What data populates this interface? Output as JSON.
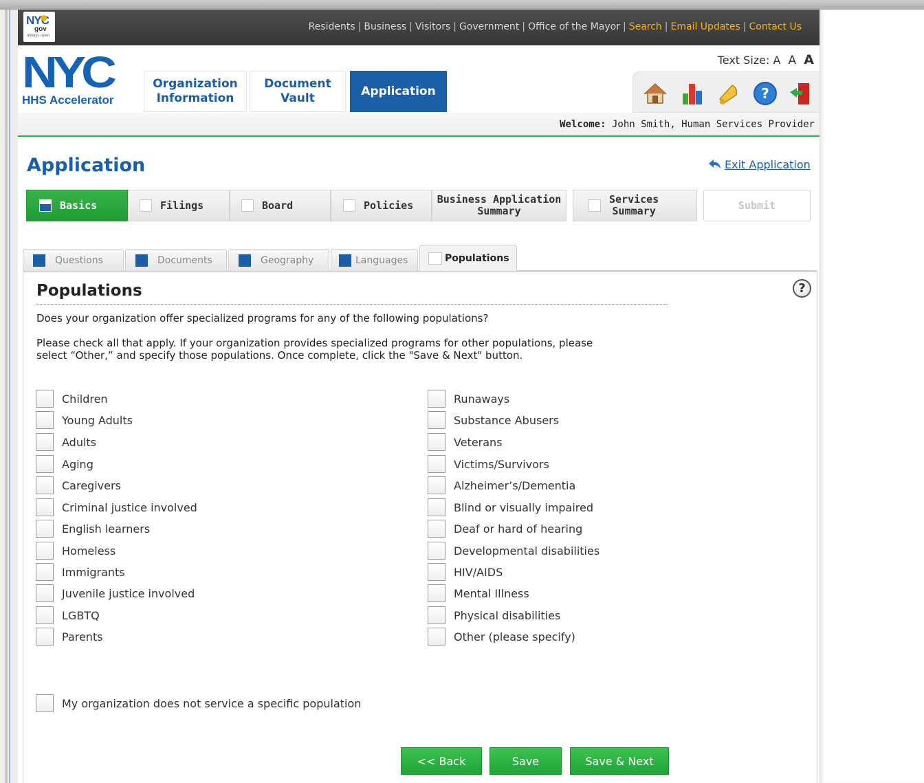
{
  "topnav": {
    "logo_text": "NYC",
    "logo_sub": "gov",
    "logo_tagline": "always open",
    "links": [
      {
        "label": "Residents",
        "highlight": false
      },
      {
        "label": "Business",
        "highlight": false
      },
      {
        "label": "Visitors",
        "highlight": false
      },
      {
        "label": "Government",
        "highlight": false
      },
      {
        "label": "Office of the Mayor",
        "highlight": false
      },
      {
        "label": "Search",
        "highlight": true
      },
      {
        "label": "Email Updates",
        "highlight": true
      },
      {
        "label": "Contact Us",
        "highlight": true
      }
    ],
    "link_color": "#d8d8d8",
    "highlight_color": "#f6b21b"
  },
  "header": {
    "logo_text": "NYC",
    "app_name": "HHS Accelerator",
    "tabs": [
      {
        "label_line1": "Organization",
        "label_line2": "Information",
        "active": false
      },
      {
        "label_line1": "Document",
        "label_line2": "Vault",
        "active": false
      },
      {
        "label_line1": "Application",
        "label_line2": "",
        "active": true
      }
    ],
    "text_size_label": "Text Size:",
    "text_size_options": [
      "A",
      "A",
      "A"
    ],
    "toolbar_icons": [
      "home-icon",
      "reports-chart-icon",
      "notifications-bell-icon",
      "help-icon",
      "logout-door-icon"
    ],
    "welcome_label": "Welcome:",
    "welcome_user": "John Smith, Human Services Provider",
    "accent_color": "#1a5fa7"
  },
  "page": {
    "title": "Application",
    "exit_link": "Exit Application"
  },
  "steps": [
    {
      "label1": "Basics",
      "label2": "",
      "state": "active"
    },
    {
      "label1": "Filings",
      "label2": "",
      "state": "normal"
    },
    {
      "label1": "Board",
      "label2": "",
      "state": "normal"
    },
    {
      "label1": "Policies",
      "label2": "",
      "state": "normal"
    },
    {
      "label1": "Business Application",
      "label2": "Summary",
      "state": "nocheck"
    },
    {
      "label1": "Services",
      "label2": "Summary",
      "state": "normal"
    },
    {
      "label1": "Submit",
      "label2": "",
      "state": "disabled"
    }
  ],
  "subtabs": [
    {
      "label": "Questions",
      "complete": true,
      "active": false
    },
    {
      "label": "Documents",
      "complete": true,
      "active": false
    },
    {
      "label": "Geography",
      "complete": true,
      "active": false
    },
    {
      "label": "Languages",
      "complete": true,
      "active": false
    },
    {
      "label": "Populations",
      "complete": false,
      "active": true
    }
  ],
  "form": {
    "title": "Populations",
    "question": "Does your organization offer specialized programs for any of the following populations?",
    "instructions_line1": "Please check all that apply. If your organization provides specialized programs for other populations, please",
    "instructions_line2": "select “Other,” and specify those populations. Once complete, click the \"Save & Next\" button.",
    "left_options": [
      "Children",
      "Young Adults",
      "Adults",
      "Aging",
      "Caregivers",
      "Criminal justice involved",
      "English learners",
      "Homeless",
      "Immigrants",
      "Juvenile justice involved",
      "LGBTQ",
      "Parents"
    ],
    "right_options": [
      "Runaways",
      "Substance Abusers",
      "Veterans",
      "Victims/Survivors",
      "Alzheimer’s/Dementia",
      "Blind or visually impaired",
      "Deaf or hard of hearing",
      "Developmental disabilities",
      "HIV/AIDS",
      "Mental Illness",
      "Physical disabilities",
      "Other (please specify)"
    ],
    "none_option": "My organization does not service a specific population"
  },
  "buttons": {
    "back": "<< Back",
    "save": "Save",
    "save_next": "Save & Next",
    "color": "#2eb543"
  }
}
